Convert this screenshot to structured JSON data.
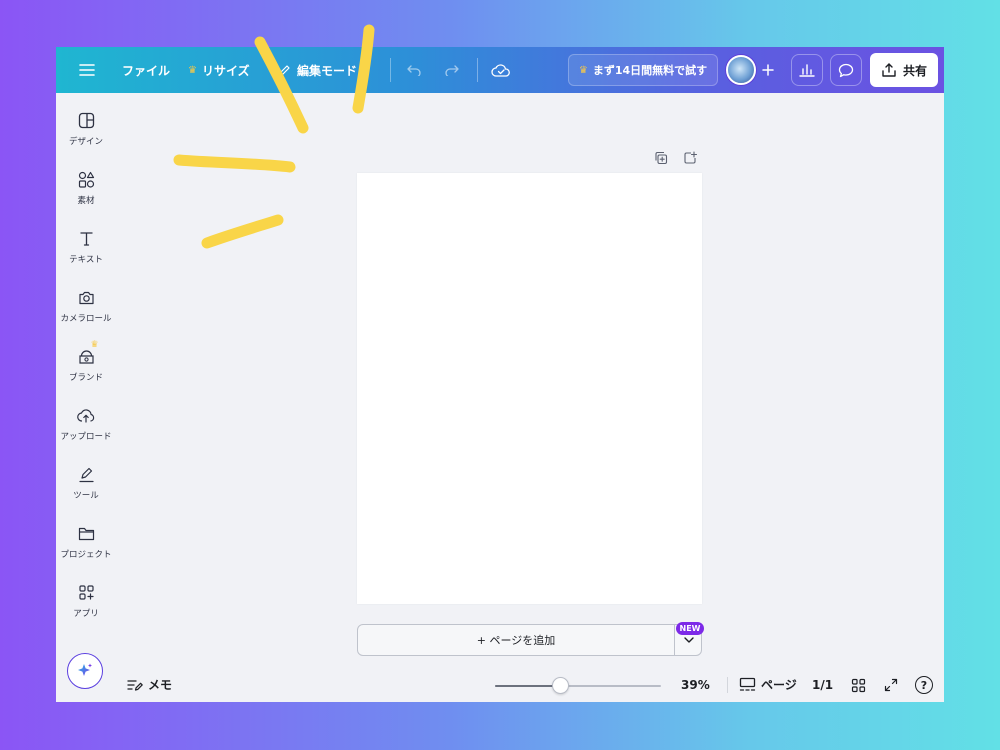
{
  "topbar": {
    "file_label": "ファイル",
    "resize_label": "リサイズ",
    "edit_mode_label": "編集モード",
    "trial_label": "まず14日間無料で試す",
    "share_label": "共有"
  },
  "sidebar": {
    "items": [
      {
        "label": "デザイン",
        "icon": "design-icon"
      },
      {
        "label": "素材",
        "icon": "elements-icon"
      },
      {
        "label": "テキスト",
        "icon": "text-icon"
      },
      {
        "label": "カメラロール",
        "icon": "camera-icon"
      },
      {
        "label": "ブランド",
        "icon": "brand-icon"
      },
      {
        "label": "アップロード",
        "icon": "upload-icon"
      },
      {
        "label": "ツール",
        "icon": "tools-icon"
      },
      {
        "label": "プロジェクト",
        "icon": "folder-icon"
      },
      {
        "label": "アプリ",
        "icon": "apps-icon"
      }
    ]
  },
  "canvas": {
    "add_page_label": "+ ページを追加",
    "new_badge": "NEW"
  },
  "bottombar": {
    "notes_label": "メモ",
    "zoom_percent": 39,
    "zoom_label": "39%",
    "pages_label": "ページ",
    "page_count": "1/1",
    "help_label": "?"
  },
  "colors": {
    "accent": "#7d2ae8",
    "topbar_start": "#1fb6d1",
    "topbar_end": "#6b52e2",
    "highlight": "#f9d548",
    "crown": "#f7c948"
  }
}
